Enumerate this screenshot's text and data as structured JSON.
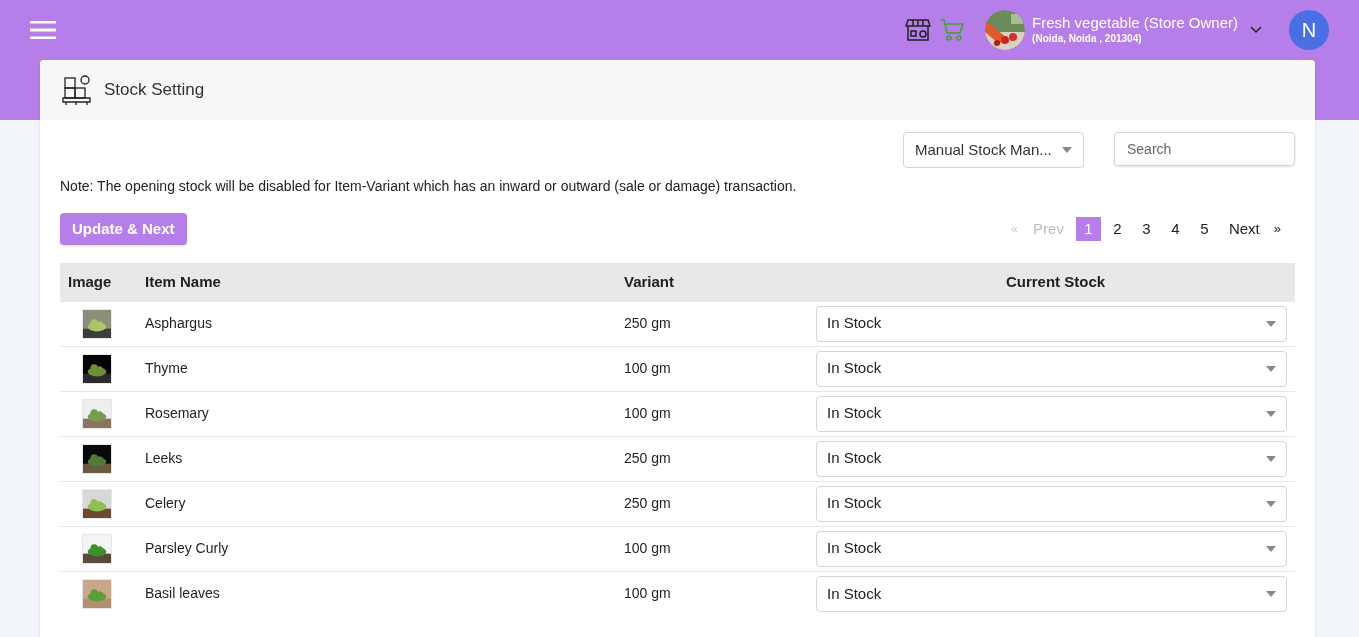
{
  "header": {
    "store_name": "Fresh vegetable (Store Owner)",
    "store_address": "(Noida, Noida , 201304)",
    "avatar_letter": "N"
  },
  "page": {
    "title": "Stock Setting"
  },
  "toolbar": {
    "mode_select": "Manual Stock Man...",
    "search": {
      "placeholder": "Search"
    }
  },
  "note": "Note: The opening stock will be disabled for Item-Variant which has an inward or outward (sale or damage) transaction.",
  "update_button": "Update & Next",
  "pagination": {
    "first": "«",
    "prev": "Prev",
    "prev_disabled": true,
    "pages": [
      {
        "label": "1",
        "selected": true
      },
      {
        "label": "2",
        "selected": false
      },
      {
        "label": "3",
        "selected": false
      },
      {
        "label": "4",
        "selected": false
      },
      {
        "label": "5",
        "selected": false
      }
    ],
    "next": "Next",
    "last": "»"
  },
  "table": {
    "columns": [
      "Image",
      "Item Name",
      "Variant",
      "Current Stock"
    ],
    "rows": [
      {
        "name": "Asphargus",
        "variant": "250 gm",
        "stock": "In Stock"
      },
      {
        "name": "Thyme",
        "variant": "100 gm",
        "stock": "In Stock"
      },
      {
        "name": "Rosemary",
        "variant": "100 gm",
        "stock": "In Stock"
      },
      {
        "name": "Leeks",
        "variant": "250 gm",
        "stock": "In Stock"
      },
      {
        "name": "Celery",
        "variant": "250 gm",
        "stock": "In Stock"
      },
      {
        "name": "Parsley Curly",
        "variant": "100 gm",
        "stock": "In Stock"
      },
      {
        "name": "Basil leaves",
        "variant": "100 gm",
        "stock": "In Stock"
      }
    ]
  }
}
